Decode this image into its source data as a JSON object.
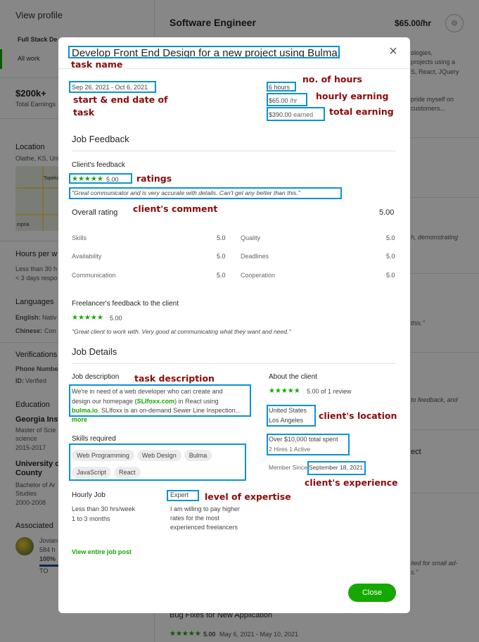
{
  "background": {
    "left": {
      "view_profile": "View profile",
      "profile_tab": "Full Stack De",
      "all_work": "All work",
      "earnings_value": "$200k+",
      "earnings_label": "Total Earnings",
      "location_heading": "Location",
      "location_value": "Olathe, KS, Uni",
      "map_labels": [
        "Topeka",
        "mpria"
      ],
      "hours_heading": "Hours per w",
      "hours_line1": "Less than 30 h",
      "hours_line2": "< 3 days respo",
      "languages_heading": "Languages",
      "lang_english": "English:",
      "lang_english_val": "Nativ",
      "lang_chinese": "Chinese:",
      "lang_chinese_val": "Con",
      "verifications_heading": "Verifications",
      "phone_number": "Phone Numbe",
      "id_verified": "ID:",
      "id_verified_val": "Verified",
      "education_heading": "Education",
      "edu1_school": "Georgia Inst",
      "edu1_degree": "Master of Scie",
      "edu1_field": "science",
      "edu1_years": "2015-2017",
      "edu2_school": "University of",
      "edu2_school2": "County",
      "edu2_degree": "Bachelor of Ar",
      "edu2_field": "Studies",
      "edu2_years": "2000-2008",
      "associated_heading": "Associated",
      "agency_name": "Jovian",
      "agency_hours": "584 h",
      "agency_percent": "100%",
      "agency_badge": "TO"
    },
    "right": {
      "job_title": "Software Engineer",
      "rate": "$65.00/hr",
      "snippet1": "ologies,",
      "snippet2": "projects using a",
      "snippet3": "S, React, JQuery",
      "snippet4": "pride myself on",
      "snippet5": "customers...",
      "snippet6": "h, demonstrating",
      "snippet7": "this.\"",
      "snippet8": "to feedback, and",
      "snippet9": "ect",
      "snippet10": "ited for small ad-",
      "snippet11": "s.\"",
      "bottom_job": "Bug Fixes for New Application",
      "bottom_stars": "★★★★★",
      "bottom_rating": "5.00",
      "bottom_dates": "May 6, 2021 - May 10, 2021"
    }
  },
  "modal": {
    "title": "Develop Front End Design for a new project using Bulma",
    "close_icon": "×",
    "date_range": "Sep 26, 2021 - Oct 6, 2021",
    "hours": "6 hours",
    "hourly_rate": "$65.00",
    "hourly_unit": "/hr",
    "total_earned": "$390.00",
    "total_earned_suffix": "earned",
    "job_feedback_heading": "Job Feedback",
    "clients_feedback_label": "Client's feedback",
    "client_stars": "★★★★★",
    "client_rating": "5.00",
    "client_comment": "\"Great communicator and is very accurate with details. Can't get any better than this.\"",
    "overall_rating_label": "Overall rating",
    "overall_rating_value": "5.00",
    "ratings": [
      {
        "label": "Skills",
        "value": "5.0"
      },
      {
        "label": "Quality",
        "value": "5.0"
      },
      {
        "label": "Availability",
        "value": "5.0"
      },
      {
        "label": "Deadlines",
        "value": "5.0"
      },
      {
        "label": "Communication",
        "value": "5.0"
      },
      {
        "label": "Cooperation",
        "value": "5.0"
      }
    ],
    "freelancer_feedback_label": "Freelancer's feedback to the client",
    "freelancer_stars": "★★★★★",
    "freelancer_rating": "5.00",
    "freelancer_comment": "\"Great client to work with. Very good at communicating what they want and need.\"",
    "job_details_heading": "Job Details",
    "job_description_label": "Job description",
    "job_description_line1": "We're in need of a web developer who can create and",
    "job_description_line2a": "design our homepage (",
    "job_description_link1": "SLIfoxx.com",
    "job_description_line2b": ") in React using",
    "job_description_link2": "bulma.io",
    "job_description_line3": ". SLIfoxx is an on-demand Sewer Line Inspection...",
    "more_link": "more",
    "about_client_label": "About the client",
    "about_stars": "★★★★★",
    "about_rating": "5.00 of 1 review",
    "client_country": "United States",
    "client_city": "Los Angeles",
    "client_spent": "Over $10,000 total spent",
    "client_hires": "2 Hires 1 Active",
    "member_since_label": "Member Since",
    "member_since_date": "September 18, 2021",
    "skills_label": "Skills required",
    "skills": [
      "Web Programming",
      "Web Design",
      "Bulma",
      "JavaScript",
      "React"
    ],
    "hourly_job_label": "Hourly Job",
    "hourly_job_hours": "Less than 30 hrs/week",
    "hourly_job_duration": "1 to 3 months",
    "expertise_level": "Expert",
    "expertise_desc1": "I am willing to pay higher",
    "expertise_desc2": "rates for the most",
    "expertise_desc3": "experienced freelancers",
    "view_job_post_link": "View entire job post",
    "close_button": "Close"
  },
  "annotations": {
    "task_name": "task name",
    "start_end_date": "start & end date of",
    "start_end_date2": "task",
    "no_of_hours": "no. of hours",
    "hourly_earning": "hourly earning",
    "total_earning": "total earning",
    "ratings": "ratings",
    "clients_comment": "client's comment",
    "task_description": "task description",
    "clients_location": "client's location",
    "clients_experience": "client's experience",
    "level_of_expertise": "level of expertise"
  },
  "colors": {
    "accent_green": "#14a800",
    "annotation_box": "#0a92d6",
    "annotation_text": "#8b0a0a",
    "overlay": "rgba(0,0,0,0.47)"
  }
}
